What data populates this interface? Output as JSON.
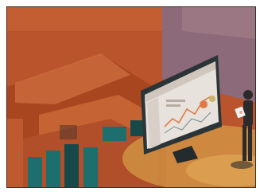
{
  "image": {
    "kind": "illustration",
    "colors": {
      "background": "#b9542c",
      "deep_orange": "#a8461f",
      "light_orange": "#cc6b3c",
      "mauve": "#8d6a79",
      "teal": "#1d6f6e",
      "dark_teal": "#17494b",
      "yellow_glow": "#d59a45",
      "monitor": "#2b3538",
      "screen": "#e7e2dc",
      "chart_orange": "#e07a45",
      "person_dark": "#2b2b2b",
      "person_skin": "#e6b08e"
    },
    "icons": [
      "dashboard-monitor-icon",
      "person-reading-icon"
    ]
  }
}
